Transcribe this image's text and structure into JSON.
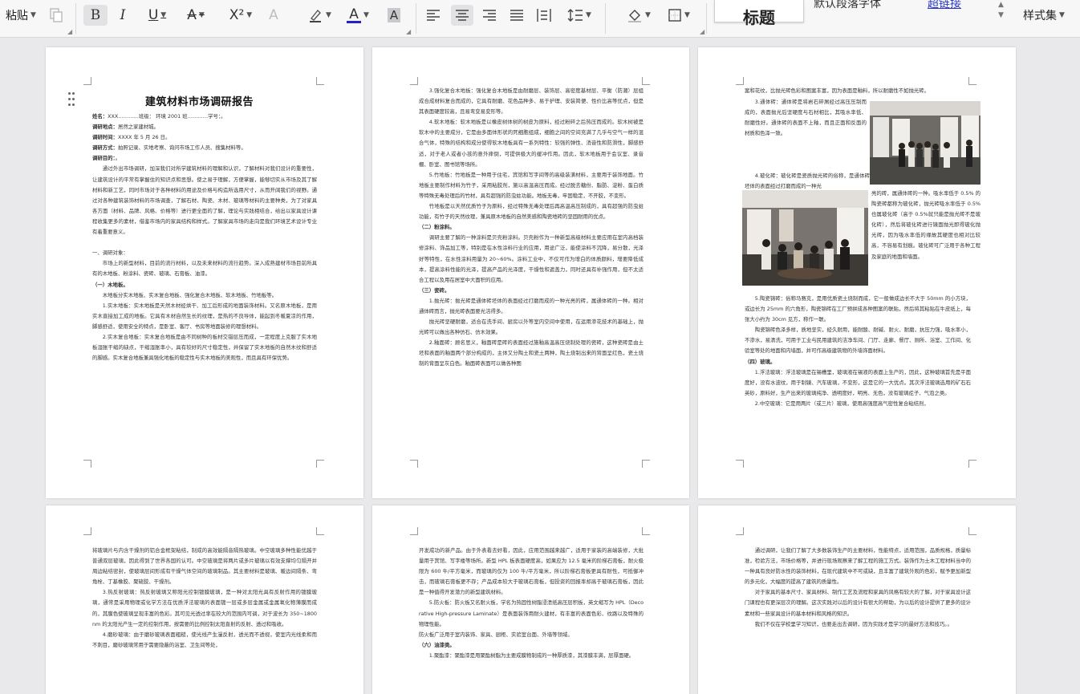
{
  "ribbon": {
    "paste_label": "粘贴",
    "format_painter_icon": "format-painter-icon",
    "bold": "B",
    "italic": "I",
    "underline": "U",
    "strikethrough": "A",
    "superscript": "X²",
    "text_effect": "A",
    "highlight_icon": "highlighter-icon",
    "font_color": "A",
    "char_shading": "A",
    "align_left_icon": "align-left-icon",
    "align_center_icon": "align-center-icon",
    "align_right_icon": "align-right-icon",
    "justify_icon": "justify-icon",
    "distributed_icon": "distributed-icon",
    "line_spacing_icon": "line-spacing-icon",
    "fill_icon": "fill-icon",
    "border_icon": "border-icon",
    "styles": [
      "标题",
      "默认段落字体",
      "超链接"
    ],
    "style_set_label": "样式集",
    "font_color_hex": "#2323c8"
  },
  "doc": {
    "title": "建筑材料市场调研报告",
    "info": [
      {
        "k": "姓名：",
        "v": "XXX…………班级：  环境 2001 班…………学号：。"
      },
      {
        "k": "调研地点：",
        "v": "居然之家建材城。"
      },
      {
        "k": "调研时间：",
        "v": "XXXX 年 5 月 26 日。"
      },
      {
        "k": "调研方式：",
        "v": "拍照记录、实地考察、询问市场工作人员、搜集材料等。"
      },
      {
        "k": "调研目的：",
        "v": "。"
      }
    ],
    "p1_paras": [
      "通过外出市场调研，加深我们对所学建筑材料的理解和认识，了解材料对我们设计的重要性，让建筑设计的平常有掌握住的知识点和思想。使之易于理解，方便掌握，能够切实从市场及其了解材料和新工艺，同时市场对于各种材料的用途及价格与构造所选用尺寸，从而开阔我们的视野。通过对各种建筑装饰材料的市场调查，了解石材、陶瓷、木材、玻璃等材料的主要种类，为了对家具各方面（材料、品牌、风格、价格等）进行更全面的了解，理论与实践相结合，给出以家具设计课程收集更多的素材，借鉴市场内的家具结构和样式。了解家具市场的走向是我们环境艺术设计专业有着重要意义。"
    ],
    "p1_sections": [
      {
        "h": "一、调研对象：",
        "body": [
          "市场上的新型材料，目前的流行材料，以及未来材料的流行趋势。深入成熟建材市场目前所具有的木地板、粉涂料、瓷砖、玻璃、石膏板、油漆。"
        ]
      },
      {
        "h": "（一）木地板。",
        "body": [
          "木地板分实木地板、实木复合地板、强化复合木地板、软木地板、竹地板等。",
          "1.实木地板：实木地板是天然木材经烘干、加工后形成的地面装饰材料。又名原木地板，是用实木直接加工成的地板。它具有木材自然生长的纹理，是热的不良导体，能起到冬暖夏凉的作用，脚感舒适，使用安全的特点，是卧室、客厅、书房等地面装修的理想材料。",
          "2.实木复合地板：实木复合地板是由不同树种的板材交错层压而成，一定程度上克服了实木地板湿胀干缩的缺点，干缩湿胀率小，具有较好的尺寸稳定性，并保留了实木地板的自然木纹和舒适的脚感。实木复合地板兼具强化地板的稳定性与实木地板的美观性，而且具有环保优势。"
        ]
      }
    ],
    "p2_paras": [
      {
        "t": "3.强化复合木地板：强化复合木地板是由耐磨层、装饰层、高密度基材层、平衡（防潮）层组成合成材料复合而成的，它具有耐磨、花色品种多、易于护理、安装简便、性价比高等优点，但是其表面硬度较高，且易弯变易变形等。",
        "h": false
      },
      {
        "t": "4.软木地板：软木地板是以橡皮树体树的树皮为原料，经过粉碎之后热压而成的。软木树被是软木中的主要成分，它是由多面体形状的死细胞组成，细胞之间的空间充满了几乎与空气一样的混合气体，特殊的结构和成分使得软木地板具有一系列特性：较强的弹性、消音性和防滑性，脚感舒适，对于老人或者小孩的意外摔倒，可提供极大的缓冲作用。因此，软木地板用于会议室、录音棚、卧室、图书馆等场所。",
        "h": false
      },
      {
        "t": "5.竹地板：竹地板是一种用于住宅，宾馆和写字间等的高级装潢材料，主要用于装饰地面。竹地板主要制作材料为竹子，采用粘胶剂，施以高温高压而成。经过脱去糖份、脂肪、淀粉、蛋白质等特殊无毒处理后的竹材，具有超强的防虫蛀功能。地板无毒，牢固稳定，不开胶，不变形。",
        "h": false
      },
      {
        "t": "竹地板是以天然优质竹子为原料，经过特殊无毒处理后再高温高压制成的，具有超强的防虫蛀功能，有竹子的天然纹理，兼具原木地板的自然美感和陶瓷地砖的坚固耐用的优点。",
        "h": false
      },
      {
        "t": "（二）粉涂料。",
        "h": true
      },
      {
        "t": "调研主要了解的一种涂料是贝壳粉涂料。贝壳粉作为一种新型高级材料主要应用在室内高档装修涂料、饰品加工等，特别是在水性涂料行业的应用，用途广泛，能使涂料不沉降，易分散，光泽好等特性，在水性涂料用量为 20~60%。涂料工业中，不仅可作为增白的体质颜料，增要降低成本，提高涂料性能的光泽，提高产品的光泽度，干燥性和遮盖力，同时还具有补强作用，但不太适合工程以及用在居室中大面积的应用。",
        "h": false
      },
      {
        "t": "（三）瓷砖。",
        "h": true
      },
      {
        "t": "1.抛光砖：抛光砖是通体砖坯体的表面经过打磨而成的一种光亮的砖，属通体砖的一种。相对通体砖而言，抛光砖表面要光洁得多。",
        "h": false
      },
      {
        "t": "抛光砖坚硬耐磨，适合在洗手间、厨房以外等室内空间中使用，在运用渗花技术的基础上，抛光砖可以做出各种仿石、仿木效果。",
        "h": false
      },
      {
        "t": "2.釉面砖：顾名思义，釉面砖是砖的表面经过施釉高温高压烧制处理的瓷砖，这种瓷砖是由土坯和表面的釉面两个部分构成的，主体又分陶土和瓷土两种，陶土烧制出来的背面呈红色，瓷土烧制的背面呈灰白色。釉面砖表面可以做各种图",
        "h": false
      }
    ],
    "p3_top": "案和花纹，比抛光砖色彩和图案丰富，因为表面是釉料，所以耐磨性不如抛光砖。",
    "p3_left1": [
      "3.通体砖：通体砖是将岩石碎屑经过高压压制而成的，表面抛光后坚硬度与石材相比，其吸水率低、耐磨性好。通体砖的表面不上釉，而且正面和反面的材质和色泽一致。"
    ],
    "p3_left2": "4.玻化砖：玻化砖是瓷质抛光砖的俗称，是通体砖坯体的表面经过打磨而成的一种光",
    "p3_right2": "亮的砖，属通体砖的一种。吸水率低于 0.5% 的陶瓷砖都称为玻化砖，抛光砖吸水率低于 0.5%也属玻化砖（高于 0.5%就只能是抛光砖不是玻化砖），然后将玻化砖进行镜面抛光即得玻化抛光砖，因为吸水率低的缘故其硬度也相对比较高，不容易有划痕。玻化砖可广泛用于各种工程及家庭的地面和墙面。",
    "p3_rest": [
      {
        "t": "5.陶瓷锦砖：俗称马赛克，是用优质瓷土烧制而成，它一般做成边长不大于 50mm 的小方块，或边长为 25mm 的六角形，陶瓷锦砖在工厂预拼成各种图案的联贴，然后将其粘贴在牛皮纸上，每张大小约为 30cm 见方，称作一联。",
        "h": false
      },
      {
        "t": "陶瓷锦砖色泽多样，质地坚实，经久耐用，能耐酸、耐碱、耐火、耐磨，抗压力强，吸水率小，不渗水，易清洗，可用于工业与民用建筑的洁净车间、门厅、走廊、餐厅、厕所、浴室、工作间、化验室等处的地面和内墙面，并可作高级建筑物的外墙饰面材料。",
        "h": false
      },
      {
        "t": "（四）玻璃。",
        "h": true
      },
      {
        "t": "1.浮法玻璃：浮法玻璃是在锡槽里，玻璃液在锡液的表面上生产的，因此，这种玻璃首先是平面度好，没有水波纹，用于制镜、汽车玻璃，不变形，这是它的一大优点。其次浮法玻璃选用的矿石石英砂，原料好，生产出来的玻璃纯净、透明度好，明亮、无色，没有玻璃疙子、气泡之类。",
        "h": false
      },
      {
        "t": "2.中空玻璃：它是用两片（或三片）玻璃，使用高强度高气密性复合粘结剂，",
        "h": false
      }
    ],
    "p4_paras": [
      {
        "t": "将玻璃片与内含干燥剂的铝合金框架粘结，制成的高效能隔音隔热玻璃。中空玻璃多种性能优越于普通双层玻璃，因此得到了世界各国的认可。中空玻璃是将两片或多片玻璃以有效支撑均匀隔开并周边粘结密封，使玻璃层间形成有干燥气体空间的玻璃制品。其主要材料是玻璃、暖边间隔条、弯角栓、丁基橡胶、聚硫胶、干燥剂。",
        "h": false,
        "ni": true
      },
      {
        "t": "3.热反射玻璃：热反射玻璃又称阳光控制镀膜玻璃，是一种对太阳光具有反射作用的镀膜玻璃，通常是采用物理或化学方法在优质浮法玻璃的表面镀一层或多层金属或金属氧化物薄膜而成的，其膜色使玻璃呈现丰富的色彩。其可见光透过率在较大的范围内可调，对于波长为 350~1800 nm 的太阳光产生一定的控制作用，按需要的比例控制太阳直射的反射、透过和吸收。",
        "h": false
      },
      {
        "t": "4.磨砂玻璃：由于磨砂玻璃表面粗糙，使光线产生漫反射，透光而不透视，使室内光线柔和而不刺目，磨砂玻璃常用于需要隐蔽的浴室、卫生间等处，",
        "h": false
      }
    ],
    "p5_paras": [
      {
        "t": "开发成功的新产品。由于外表看去好看，因此，应用范围越来越广，适用于家装的高端装修，大批量用于宾馆、写字楼等场所。新型 HPL 板表面硬度高，如果应为 12.5 毫米的阶梯石膏板，耐火极限为 600 牛/平方毫米，而玻璃的仅为 100 牛/平方毫米，所以阶梯石膏板更具有耐性，可抵御冲击，而玻璃石膏板更不存；产品成本较大于玻璃石膏板，但投资的回报率却高于玻璃石膏板，因此是一种值得开发潜力的新型建筑材料。",
        "h": false,
        "ni": true
      },
      {
        "t": "5.防火板：防火板又名耐火板，学名为热固性树脂浸渍纸高压层积板，英文缩写为 HPL（Decorative High-pressure Laminate）是表面装饰用耐火建材，有丰富的表面色彩、纹路以及特殊的物理性能。",
        "h": false
      },
      {
        "t": "防火板广泛用于室内装饰、家具、厨柜、实验室台面、外墙等领域。",
        "h": false,
        "ni": true
      },
      {
        "t": "（六）油漆类。",
        "h": true
      },
      {
        "t": "1.聚酯漆：聚酯漆是用聚酯树脂为主要成膜物制成的一种厚质漆，其漆膜丰满，层厚面硬。",
        "h": false
      }
    ],
    "p6_paras": [
      {
        "t": "通过调研，让我们了解了大多数装饰生产的主要材料，性能特点，适用范围，品质规格，质量标准，检验方法，市场价格等，并进行现场观察来了解工程的施工方式。装饰作为土木工程材料当中的一种具有良好防水性的装饰材料，在现代建筑中不可或缺，且丰富了建筑外观的色彩，赋予更加新型的多元化，大幅度的提高了建筑的质量性。",
        "h": false
      },
      {
        "t": "对于家具的基本尺寸、家具材料、制作工艺及流程和家具的风格有较大的了解，对于家具设计这门课程也有更深层次的理解。这次实践对以后的设计有很大的帮助，为以后的设计提供了更多的设计素材和一些家具设计的基本材料和风格的知识。",
        "h": false
      },
      {
        "t": "我们不仅在学校里学习知识，也要走出去调研，因为实践才是学习的最好方法和技巧。。",
        "h": false
      }
    ]
  }
}
